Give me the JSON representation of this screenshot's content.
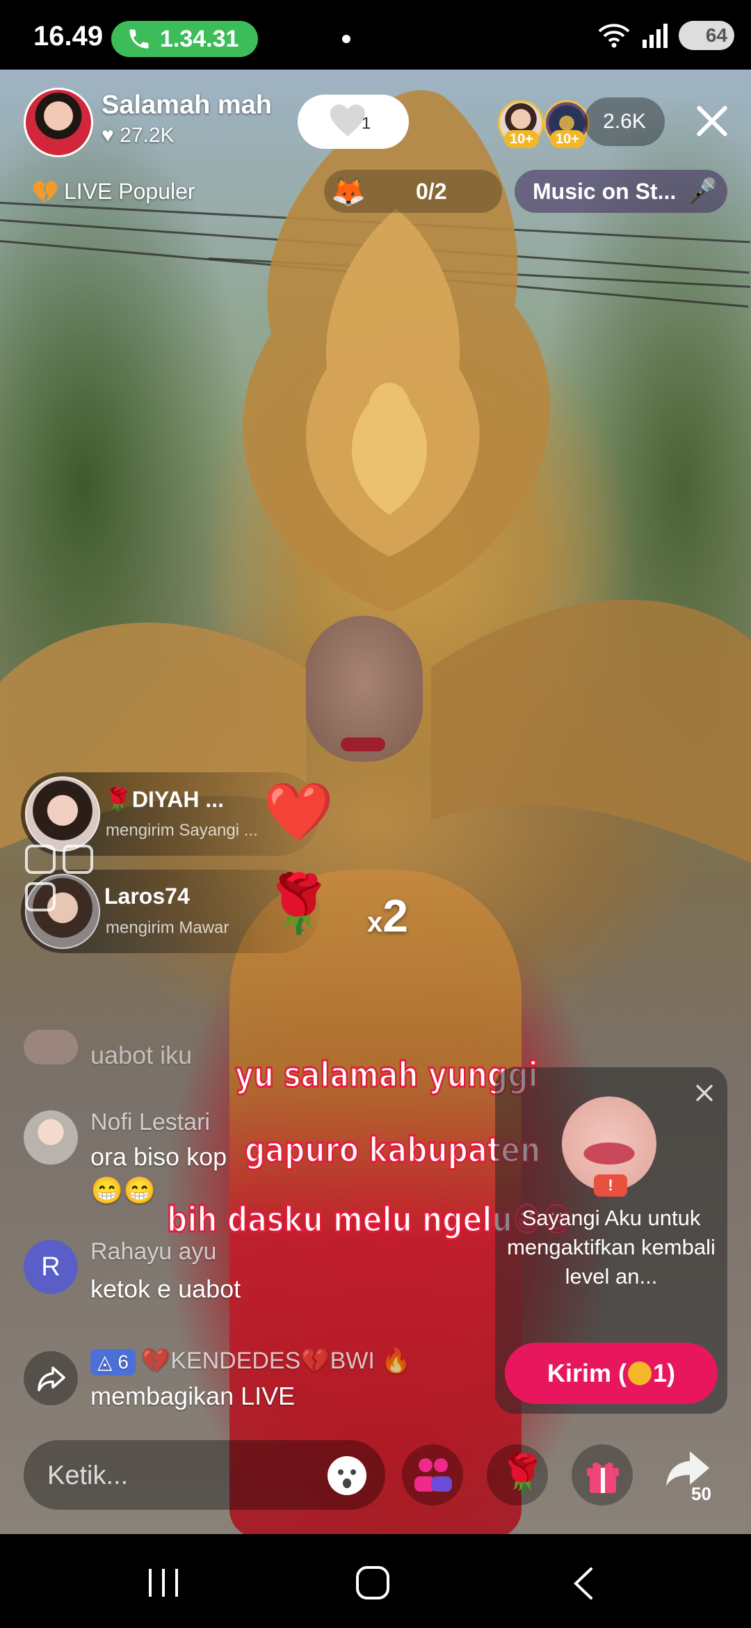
{
  "status_bar": {
    "time": "16.49",
    "call_duration": "1.34.31",
    "battery": "64",
    "signal_label": "5"
  },
  "host": {
    "name": "Salamah mah",
    "likes": "27.2K",
    "like_button_count": "1"
  },
  "viewers": {
    "count": "2.6K",
    "badge_1": "10+",
    "badge_2": "10+"
  },
  "popular_label": "LIVE Populer",
  "task_progress": "0/2",
  "music_label": "Music on St...",
  "gifts": [
    {
      "name": "DIYAH ...",
      "action": "mengirim Sayangi ..."
    },
    {
      "name": "Laros74",
      "action": "mengirim Mawar",
      "multiplier": "2",
      "multiplier_prefix": "x"
    }
  ],
  "chat": [
    {
      "name": "",
      "message": "uabot iku"
    },
    {
      "name": "Nofi Lestari",
      "message": "ora biso kop",
      "emoji": "😁😁"
    },
    {
      "name": "Rahayu ayu",
      "avatar_letter": "R",
      "message": "ketok e uabot"
    },
    {
      "level": "6",
      "name": "💔KENDEDES💔BWI 🔥",
      "message": "membagikan LIVE"
    }
  ],
  "overlay_lines": [
    "yu salamah yunggi",
    "gapuro kabupaten",
    "bih dasku melu ngelu😃😃"
  ],
  "promo": {
    "badge": "!",
    "text": "Sayangi Aku untuk mengaktifkan kembali level an...",
    "button": "Kirim (",
    "button_coin": "1",
    "button_suffix": ")"
  },
  "comment_placeholder": "Ketik...",
  "share_count": "50",
  "colors": {
    "call_green": "#3dbd5a",
    "send_pink": "#e8175d",
    "overlay_stroke": "#e41b3c"
  }
}
